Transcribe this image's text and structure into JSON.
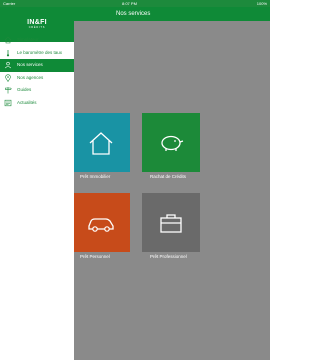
{
  "status_bar": {
    "carrier": "Carrier",
    "time": "8:07 PM",
    "battery": "100%"
  },
  "header": {
    "title": "Nos services"
  },
  "drawer": {
    "logo": {
      "line1": "IN&FI",
      "line2": "CRÉDITS"
    },
    "items": [
      {
        "label": "Simulateur",
        "icon": "calculator-icon",
        "active": false
      },
      {
        "label": "Le baromètre des taux",
        "icon": "thermometer-icon",
        "active": false
      },
      {
        "label": "Nos services",
        "icon": "users-icon",
        "active": true
      },
      {
        "label": "Nos agences",
        "icon": "map-pin-icon",
        "active": false
      },
      {
        "label": "Guides",
        "icon": "signpost-icon",
        "active": false
      },
      {
        "label": "Actualités",
        "icon": "news-icon",
        "active": false
      }
    ]
  },
  "services": [
    {
      "label": "Prêt Immobilier",
      "icon": "house-icon",
      "color": "#1993a4"
    },
    {
      "label": "Rachat de Crédits",
      "icon": "piggy-bank-icon",
      "color": "#1c8a39"
    },
    {
      "label": "Prêt Personnel",
      "icon": "car-icon",
      "color": "#c74b1a"
    },
    {
      "label": "Prêt Professionnel",
      "icon": "briefcase-icon",
      "color": "#6a6a6a"
    }
  ],
  "colors": {
    "brand_green": "#0f8a37",
    "overlay_gray": "#8a8a8a"
  }
}
